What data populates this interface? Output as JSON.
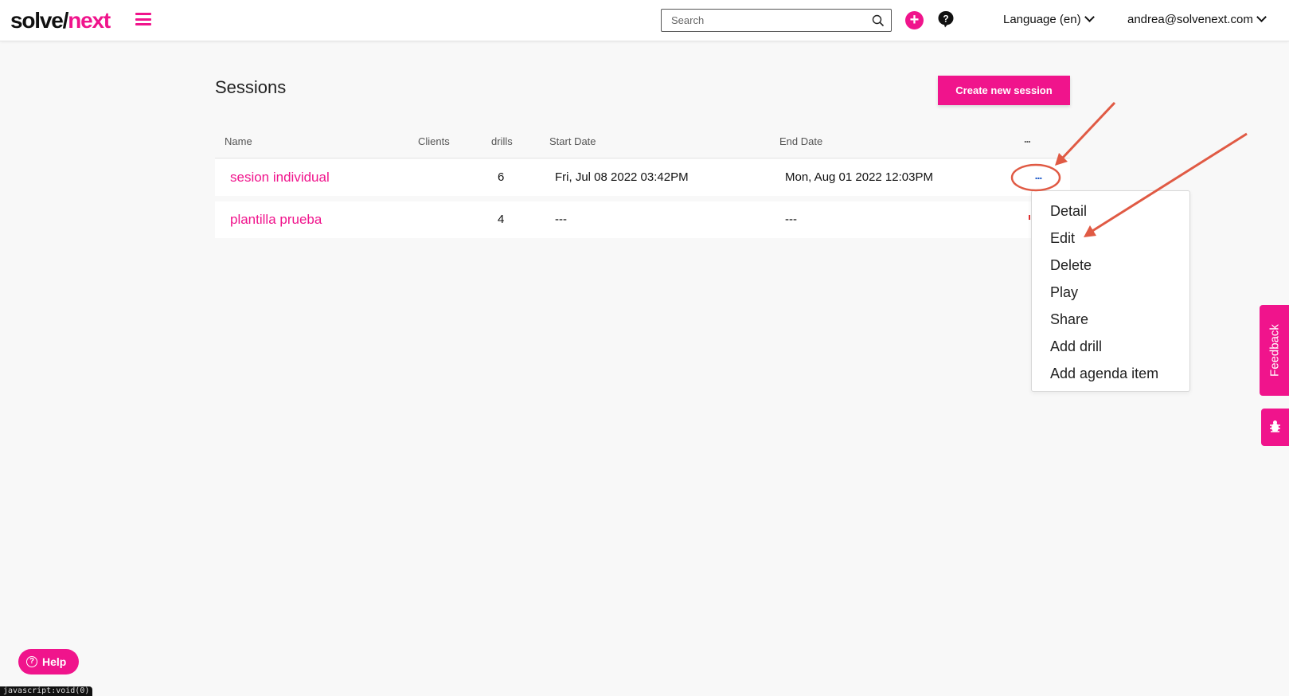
{
  "header": {
    "logo_part1": "solve/",
    "logo_part2": "next",
    "search_placeholder": "Search",
    "language": "Language (en)",
    "user_email": "andrea@solvenext.com",
    "plus_label": "+"
  },
  "page": {
    "title": "Sessions",
    "create_button": "Create new session"
  },
  "table": {
    "columns": [
      "Name",
      "Clients",
      "drills",
      "Start Date",
      "End Date",
      "..."
    ],
    "rows": [
      {
        "name": "sesion individual",
        "clients": "",
        "drills": "6",
        "start_date": "Fri, Jul 08 2022 03:42PM",
        "end_date": "Mon, Aug 01 2022 12:03PM",
        "actions": "..."
      },
      {
        "name": "plantilla prueba",
        "clients": "",
        "drills": "4",
        "start_date": "---",
        "end_date": "---"
      }
    ]
  },
  "actions_menu": {
    "items": [
      "Detail",
      "Edit",
      "Delete",
      "Play",
      "Share",
      "Add drill",
      "Add agenda item"
    ]
  },
  "side_tabs": {
    "feedback": "Feedback"
  },
  "help_button": "Help",
  "status_bar": "javascript:void(0)",
  "colors": {
    "brand": "#f0148c",
    "action_dots": "#1a57c8",
    "annotation": "#e05a44"
  }
}
